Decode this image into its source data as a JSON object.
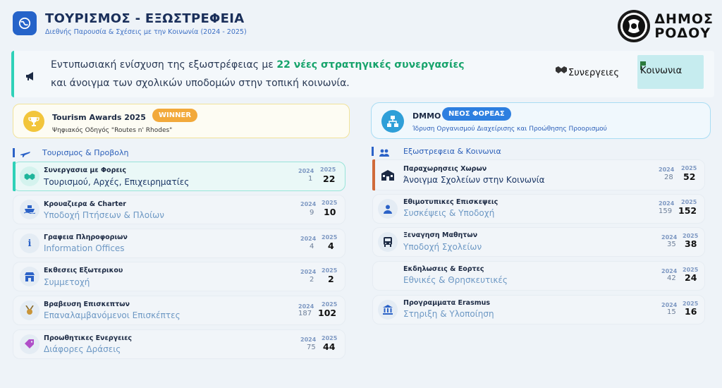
{
  "header": {
    "title": "ΤΟΥΡΙΣΜΟΣ - ΕΞΩΣΤΡΕΦΕΙΑ",
    "subtitle": "Διεθνής Παρουσία & Σχέσεις με την Κοινωνία (2024 - 2025)",
    "brand_line1": "ΔΗΜΟΣ",
    "brand_line2": "ΡΟΔΟΥ"
  },
  "banner": {
    "line1_prefix": "Εντυπωσιακή ενίσχυση της εξωστρέφειας με",
    "line1_highlight": "22 νέες στρατηγικές συνεργασίες",
    "line2": "και άνοιγμα των σχολικών υποδομών στην τοπική κοινωνία.",
    "tag1": "Συνεργειες",
    "tag2": "Κοινωνια"
  },
  "awards": {
    "left": {
      "title": "Tourism Awards 2025",
      "badge": "WINNER",
      "subtitle": "Ψηφιακός Οδηγός \"Routes n' Rhodes\""
    },
    "right": {
      "title": "DMMO",
      "badge": "ΝΕΟΣ ΦΟΡΕΑΣ",
      "subtitle": "Ίδρυση Οργανισμού Διαχείρισης και Προώθησης Προορισμού"
    }
  },
  "colors": {
    "accent": "#2563c9",
    "teal": "#2fd1b8",
    "winner": "#f2a93b",
    "highlight": "#16a36b",
    "active_border": "#d06a3a"
  },
  "left_section": {
    "title": "Τουρισμος & Προβολη",
    "rows": [
      {
        "icon": "handshake-icon",
        "title": "Συνεργασια με Φορεις",
        "subtitle": "Τουρισμού, Αρχές, Επιχειρηματίες",
        "y1": "2024",
        "y2": "2025",
        "v1": "1",
        "v2": "22"
      },
      {
        "icon": "ship-icon",
        "title": "Κρουαζιερα & Charter",
        "subtitle": "Υποδοχή Πτήσεων & Πλοίων",
        "y1": "2024",
        "y2": "2025",
        "v1": "9",
        "v2": "10"
      },
      {
        "icon": "info-icon",
        "title": "Γραφεια Πληροφοριων",
        "subtitle": "Information Offices",
        "y1": "2024",
        "y2": "2025",
        "v1": "4",
        "v2": "4"
      },
      {
        "icon": "store-icon",
        "title": "Εκθεσεις Εξωτερικου",
        "subtitle": "Συμμετοχή",
        "y1": "2024",
        "y2": "2025",
        "v1": "2",
        "v2": "2"
      },
      {
        "icon": "medal-icon",
        "title": "Βραβευση Επισκεπτων",
        "subtitle": "Επαναλαμβανόμενοι Επισκέπτες",
        "y1": "2024",
        "y2": "2025",
        "v1": "187",
        "v2": "102"
      },
      {
        "icon": "tag-icon",
        "title": "Προωθητικες Ενεργειες",
        "subtitle": "Διάφορες Δράσεις",
        "y1": "2024",
        "y2": "2025",
        "v1": "75",
        "v2": "44"
      }
    ]
  },
  "right_section": {
    "title": "Εξωστρεφεια & Κοινωνια",
    "rows": [
      {
        "icon": "school-icon",
        "title": "Παραχωρησεις Χωρων",
        "subtitle": "Άνοιγμα Σχολείων στην Κοινωνία",
        "y1": "2024",
        "y2": "2025",
        "v1": "28",
        "v2": "52"
      },
      {
        "icon": "user-tie-icon",
        "title": "Εθιμοτυπικες Επισκεψεις",
        "subtitle": "Συσκέψεις & Υποδοχή",
        "y1": "2024",
        "y2": "2025",
        "v1": "159",
        "v2": "152"
      },
      {
        "icon": "bus-icon",
        "title": "Ξεναγηση Μαθητων",
        "subtitle": "Υποδοχή Σχολείων",
        "y1": "2024",
        "y2": "2025",
        "v1": "35",
        "v2": "38"
      },
      {
        "icon": "calendar-icon",
        "title": "Εκδηλωσεις & Εορτες",
        "subtitle": "Εθνικές & Θρησκευτικές",
        "y1": "2024",
        "y2": "2025",
        "v1": "42",
        "v2": "24"
      },
      {
        "icon": "bank-icon",
        "title": "Προγραμματα Erasmus",
        "subtitle": "Στηριξη & Υλοποίηση",
        "y1": "2024",
        "y2": "2025",
        "v1": "15",
        "v2": "16"
      }
    ]
  }
}
